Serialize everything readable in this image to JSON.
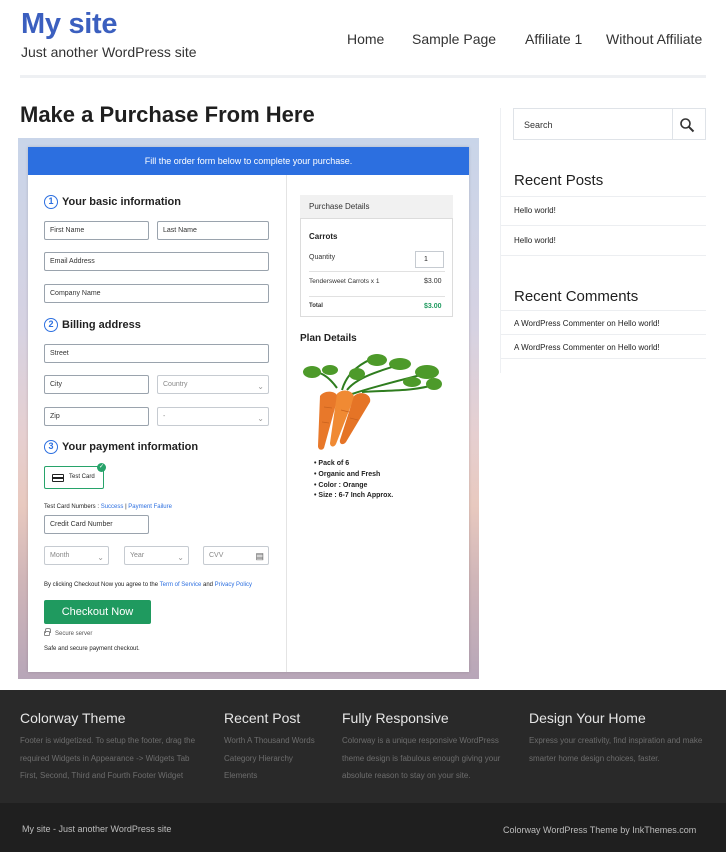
{
  "site": {
    "title": "My site",
    "tagline": "Just another WordPress site",
    "nav": [
      "Home",
      "Sample Page",
      "Affiliate 1",
      "Without Affiliate"
    ]
  },
  "page_title": "Make a Purchase From Here",
  "form": {
    "banner": "Fill the order form below to complete your purchase.",
    "step1": {
      "number": "1",
      "title": "Your basic information"
    },
    "step2": {
      "number": "2",
      "title": "Billing address"
    },
    "step3": {
      "number": "3",
      "title": "Your payment information"
    },
    "first_name": "First Name",
    "last_name": "Last Name",
    "email": "Email Address",
    "company": "Company Name",
    "street": "Street",
    "city": "City",
    "country": "Country",
    "zip": "Zip",
    "state": "-",
    "test_card": "Test Card",
    "test_card_numbers_label": "Test Card Numbers :",
    "success_link": "Success",
    "separator": "|",
    "failure_link": "Payment Failure",
    "card_number": "Credit Card Number",
    "month": "Month",
    "year": "Year",
    "cvv": "CVV",
    "terms_prefix": "By clicking Checkout Now you agree to the",
    "terms_link": "Term of Service",
    "terms_and": "and",
    "privacy_link": "Privacy Policy",
    "checkout_button": "Checkout Now",
    "secure_server": "Secure server",
    "safe_text": "Safe and secure payment checkout."
  },
  "purchase": {
    "heading": "Purchase Details",
    "product": "Carrots",
    "quantity_label": "Quantity",
    "quantity": "1",
    "line_item": "Tendersweet Carrots x 1",
    "line_price": "$3.00",
    "total_label": "Total",
    "total_price": "$3.00"
  },
  "plan": {
    "title": "Plan Details",
    "bullets": [
      "Pack of 6",
      "Organic and Fresh",
      "Color : Orange",
      "Size : 6-7 Inch Approx."
    ]
  },
  "sidebar": {
    "search_placeholder": "Search",
    "recent_posts_title": "Recent Posts",
    "recent_posts": [
      "Hello world!",
      "Hello world!"
    ],
    "recent_comments_title": "Recent Comments",
    "recent_comments": [
      {
        "author": "A WordPress Commenter",
        "on": "on",
        "post": "Hello world!"
      },
      {
        "author": "A WordPress Commenter",
        "on": "on",
        "post": "Hello world!"
      }
    ]
  },
  "footer": {
    "col1": {
      "title": "Colorway Theme",
      "lines": [
        "Footer is widgetized. To setup the footer, drag the",
        "required Widgets in Appearance -> Widgets Tab",
        "First, Second, Third and Fourth Footer Widget"
      ]
    },
    "col2": {
      "title": "Recent Post",
      "lines": [
        "Worth A Thousand Words",
        "Category Hierarchy",
        "Elements"
      ]
    },
    "col3": {
      "title": "Fully Responsive",
      "lines": [
        "Colorway is a unique responsive WordPress",
        "theme design is fabulous enough giving your",
        "absolute reason to stay on your site."
      ]
    },
    "col4": {
      "title": "Design Your Home",
      "lines": [
        "Express your creativity, find inspiration and make",
        "smarter home design choices, faster."
      ]
    },
    "bottom_left": "My site - Just another WordPress site",
    "bottom_right": "Colorway WordPress Theme by InkThemes.com"
  },
  "colors": {
    "brand": "#3b5fbf",
    "banner": "#2c6fe0",
    "checkout": "#1f9a5f",
    "price_total": "#1f9a5f",
    "footer": "#292929"
  }
}
